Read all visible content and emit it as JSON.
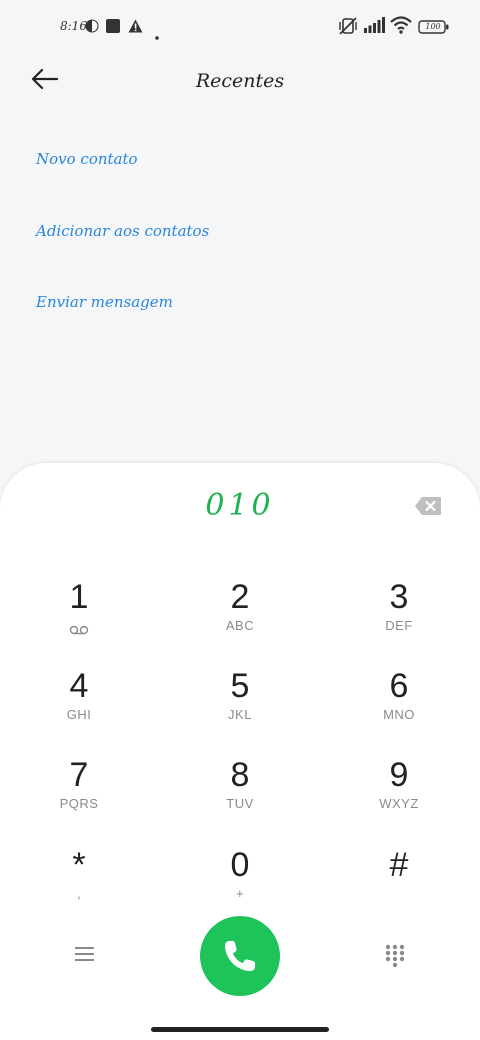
{
  "status_bar": {
    "time": "8:16",
    "battery": "100",
    "icons": [
      "moon-icon",
      "square-notification-icon",
      "warning-icon",
      "dot-icon",
      "vibrate-off-icon",
      "signal-icon",
      "wifi-icon",
      "battery-icon"
    ]
  },
  "header": {
    "title": "Recentes",
    "back_icon": "arrow-left-icon"
  },
  "actions": [
    {
      "label": "Novo contato"
    },
    {
      "label": "Adicionar aos contatos"
    },
    {
      "label": "Enviar mensagem"
    }
  ],
  "dialer": {
    "number": "010",
    "backspace_icon": "backspace-icon",
    "keys": [
      {
        "digit": "1",
        "letters": "",
        "sub_icon": "voicemail-icon"
      },
      {
        "digit": "2",
        "letters": "ABC"
      },
      {
        "digit": "3",
        "letters": "DEF"
      },
      {
        "digit": "4",
        "letters": "GHI"
      },
      {
        "digit": "5",
        "letters": "JKL"
      },
      {
        "digit": "6",
        "letters": "MNO"
      },
      {
        "digit": "7",
        "letters": "PQRS"
      },
      {
        "digit": "8",
        "letters": "TUV"
      },
      {
        "digit": "9",
        "letters": "WXYZ"
      },
      {
        "digit": "*",
        "letters": ","
      },
      {
        "digit": "0",
        "letters": "+"
      },
      {
        "digit": "#",
        "letters": ""
      }
    ],
    "bottom": {
      "menu_icon": "hamburger-menu-icon",
      "call_icon": "phone-icon",
      "dialpad_icon": "dialpad-icon"
    }
  },
  "colors": {
    "accent_link": "#2a86d9",
    "number_green": "#1eb24f",
    "call_green": "#1ec45a",
    "background": "#f5f6f8"
  }
}
